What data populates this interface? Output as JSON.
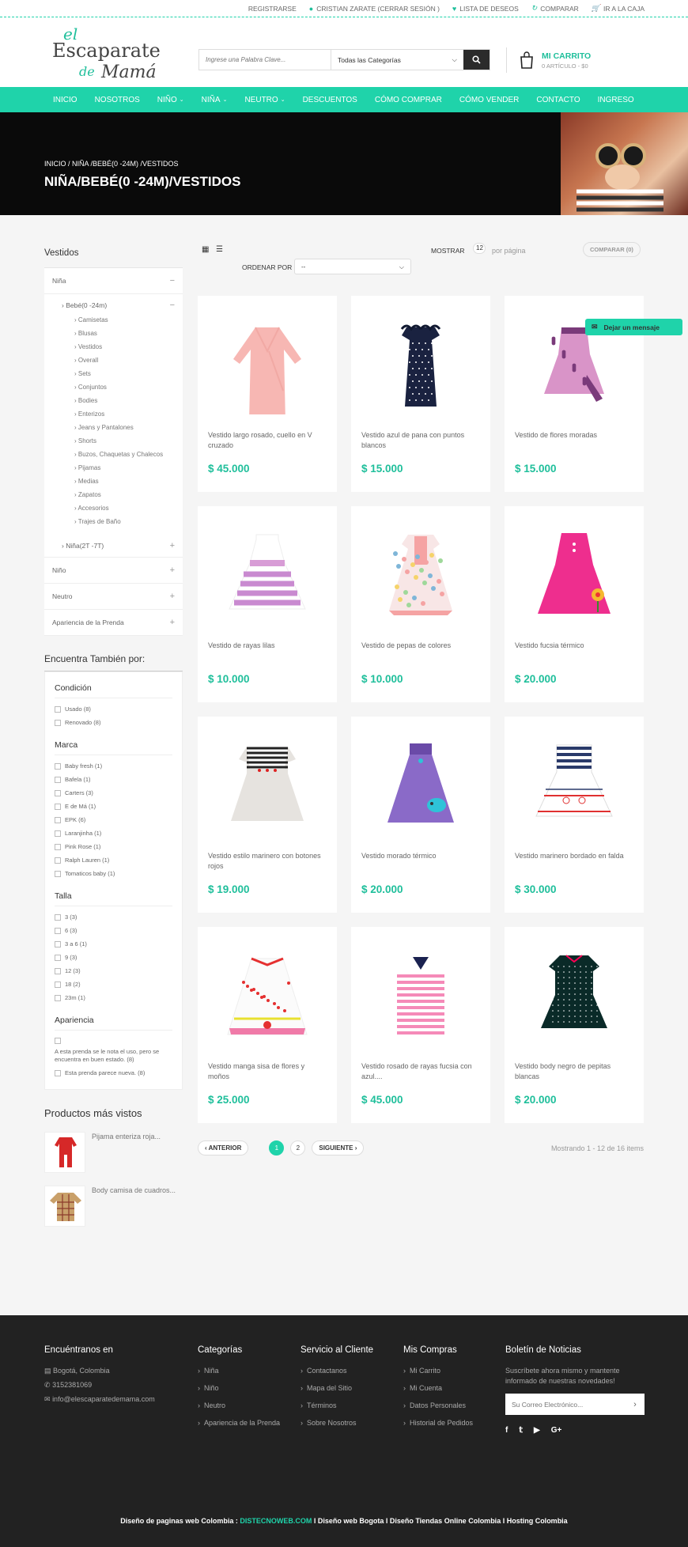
{
  "topbar": {
    "register": "REGISTRARSE",
    "user": "CRISTIAN ZARATE (CERRAR SESIÓN )",
    "wishlist": "LISTA DE DESEOS",
    "compare": "COMPARAR",
    "checkout": "IR A LA CAJA"
  },
  "logo": {
    "l1": "el",
    "l2": "Escaparate",
    "l3": "de",
    "l4": "Mamá"
  },
  "search": {
    "placeholder": "Ingrese una Palabra Clave...",
    "category": "Todas las Categorías"
  },
  "cart": {
    "title": "MI CARRITO",
    "summary": "0 ARTÍCULO - $0"
  },
  "nav": [
    {
      "label": "INICIO",
      "dropdown": false
    },
    {
      "label": "NOSOTROS",
      "dropdown": false
    },
    {
      "label": "NIÑO",
      "dropdown": true
    },
    {
      "label": "NIÑA",
      "dropdown": true
    },
    {
      "label": "NEUTRO",
      "dropdown": true
    },
    {
      "label": "DESCUENTOS",
      "dropdown": false
    },
    {
      "label": "CÓMO COMPRAR",
      "dropdown": false
    },
    {
      "label": "CÓMO VENDER",
      "dropdown": false
    },
    {
      "label": "CONTACTO",
      "dropdown": false
    },
    {
      "label": "INGRESO",
      "dropdown": false
    }
  ],
  "hero": {
    "breadcrumb": "INICIO  /  NIÑA  /BEBÉ(0 -24M)  /VESTIDOS",
    "title": "NIÑA/BEBÉ(0 -24M)/VESTIDOS"
  },
  "sidebar": {
    "title": "Vestidos",
    "nina": "Niña",
    "bebe": "Bebé(0 -24m)",
    "leaves": [
      "Camisetas",
      "Blusas",
      "Vestidos",
      "Overall",
      "Sets",
      "Conjuntos",
      "Bodies",
      "Enterizos",
      "Jeans y Pantalones",
      "Shorts",
      "Buzos, Chaquetas y Chalecos",
      "Pijamas",
      "Medias",
      "Zapatos",
      "Accesorios",
      "Trajes de Baño"
    ],
    "nina2": "Niña(2T -7T)",
    "others": [
      "Niño",
      "Neutro",
      "Apariencia de la Prenda"
    ]
  },
  "filters": {
    "title": "Encuentra También por:",
    "condicion": {
      "title": "Condición",
      "options": [
        "Usado (8)",
        "Renovado (8)"
      ]
    },
    "marca": {
      "title": "Marca",
      "options": [
        "Baby fresh (1)",
        "Bafela (1)",
        "Carters (3)",
        "E de Má (1)",
        "EPK (6)",
        "Laranjinha (1)",
        "Pink Rose (1)",
        "Ralph Lauren (1)",
        "Tomaticos baby (1)"
      ]
    },
    "talla": {
      "title": "Talla",
      "options": [
        "3 (3)",
        "6 (3)",
        "3 a 6 (1)",
        "9 (3)",
        "12 (3)",
        "18 (2)",
        "23m (1)"
      ]
    },
    "apariencia": {
      "title": "Apariencia",
      "options": [
        "A esta prenda se le nota el uso, pero se encuentra en buen estado. (8)",
        "Esta prenda parece nueva. (8)"
      ]
    }
  },
  "viewed": {
    "title": "Productos más vistos",
    "items": [
      {
        "name": "Pijama enteriza roja..."
      },
      {
        "name": "Body camisa de cuadros..."
      }
    ]
  },
  "toolbar": {
    "show": "MOSTRAR",
    "show_value": "12",
    "per_page": "por página",
    "order": "ORDENAR POR",
    "order_value": "--",
    "compare": "COMPARAR (0)"
  },
  "products": [
    {
      "name": "Vestido largo rosado, cuello en V cruzado",
      "price": "$ 45.000",
      "dress": "long",
      "colors": [
        "#f7b7b3",
        "#f9c6c2",
        "#f1a9a4"
      ]
    },
    {
      "name": "Vestido azul de pana con puntos blancos",
      "price": "$ 15.000",
      "dress": "ruffle",
      "colors": [
        "#1a2240",
        "#ffffff",
        "#101830"
      ]
    },
    {
      "name": "Vestido de flores moradas",
      "price": "$ 15.000",
      "dress": "floral",
      "colors": [
        "#d994c8",
        "#7a3a7a",
        "#c77fb6"
      ]
    },
    {
      "name": "Vestido de rayas lilas",
      "price": "$ 10.000",
      "dress": "stripe",
      "colors": [
        "#d89cd6",
        "#ffffff",
        "#c98ad0"
      ]
    },
    {
      "name": "Vestido de pepas de colores",
      "price": "$ 10.000",
      "dress": "dots",
      "colors": [
        "#f8e6e6",
        "#7fb6d8",
        "#f5a3a3"
      ]
    },
    {
      "name": "Vestido fucsia térmico",
      "price": "$ 20.000",
      "dress": "plain",
      "colors": [
        "#ee2e8e",
        "#ff5aa8",
        "#d81f7c"
      ]
    },
    {
      "name": "Vestido estilo marinero con botones rojos",
      "price": "$ 19.000",
      "dress": "sailor",
      "colors": [
        "#e6e3df",
        "#222222",
        "#ffffff"
      ]
    },
    {
      "name": "Vestido morado térmico",
      "price": "$ 20.000",
      "dress": "purple",
      "colors": [
        "#8a6ac8",
        "#6a4aa8",
        "#2ec3d8"
      ]
    },
    {
      "name": "Vestido marinero bordado en falda",
      "price": "$ 30.000",
      "dress": "sailor2",
      "colors": [
        "#ffffff",
        "#2a3a6a",
        "#e03030"
      ]
    },
    {
      "name": "Vestido manga sisa de flores y moños",
      "price": "$ 25.000",
      "dress": "flower",
      "colors": [
        "#fbfbfb",
        "#f07aa8",
        "#e53030"
      ]
    },
    {
      "name": "Vestido rosado de rayas fucsia con azul....",
      "price": "$ 45.000",
      "dress": "polo",
      "colors": [
        "#f58ab8",
        "#ffffff",
        "#1a2250"
      ]
    },
    {
      "name": "Vestido body negro de pepitas blancas",
      "price": "$ 20.000",
      "dress": "body",
      "colors": [
        "#0a2a28",
        "#ffffff",
        "#0c1c1a"
      ]
    }
  ],
  "pager": {
    "prev": "ANTERIOR",
    "p1": "1",
    "p2": "2",
    "next": "SIGUIENTE",
    "info": "Mostrando 1 - 12 de 16 items"
  },
  "message": "Dejar un mensaje",
  "footer": {
    "find": {
      "title": "Encuéntranos en",
      "items": [
        "Bogotá, Colombia",
        "3152381069",
        "info@elescaparatedemama.com"
      ]
    },
    "cats": {
      "title": "Categorías",
      "items": [
        "Niña",
        "Niño",
        "Neutro",
        "Apariencia de la Prenda"
      ]
    },
    "service": {
      "title": "Servicio al Cliente",
      "items": [
        "Contactanos",
        "Mapa del Sitio",
        "Términos",
        "Sobre Nosotros"
      ]
    },
    "purchases": {
      "title": "Mis Compras",
      "items": [
        "Mi Carrito",
        "Mi Cuenta",
        "Datos Personales",
        "Historial de Pedidos"
      ]
    },
    "news": {
      "title": "Boletín de Noticias",
      "text": "Suscríbete ahora mismo y mantente informado de nuestras novedades!",
      "placeholder": "Su Correo Electrónico..."
    },
    "social": [
      "f",
      "t",
      "yt",
      "G+"
    ],
    "copy_a": "Diseño de paginas web Colombia : ",
    "copy_link": "DISTECNOWEB.COM",
    "copy_b": " l Diseño web Bogota l Diseño Tiendas Online Colombia l Hosting Colombia"
  }
}
